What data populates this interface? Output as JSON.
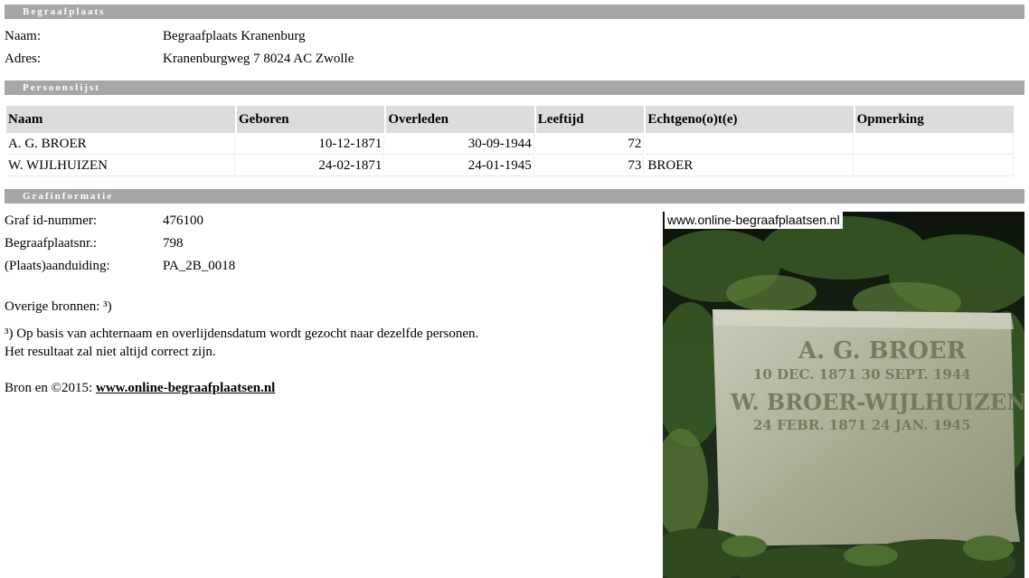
{
  "cemetery_section": {
    "title": "Begraafplaats",
    "name_label": "Naam:",
    "name_value": "Begraafplaats Kranenburg",
    "address_label": "Adres:",
    "address_value": "Kranenburgweg 7 8024 AC Zwolle"
  },
  "persons_section": {
    "title": "Persoonslijst",
    "columns": [
      "Naam",
      "Geboren",
      "Overleden",
      "Leeftijd",
      "Echtgeno(o)t(e)",
      "Opmerking"
    ],
    "rows": [
      [
        "A. G. BROER",
        "10-12-1871",
        "30-09-1944",
        "72",
        "",
        ""
      ],
      [
        "W. WIJLHUIZEN",
        "24-02-1871",
        "24-01-1945",
        "73",
        "BROER",
        ""
      ]
    ]
  },
  "grave_section": {
    "title": "Grafinformatie",
    "grave_id_label": "Graf id-nummer:",
    "grave_id_value": "476100",
    "cemetery_nr_label": "Begraafplaatsnr.:",
    "cemetery_nr_value": "798",
    "location_label": "(Plaats)aanduiding:",
    "location_value": "PA_2B_0018",
    "other_sources": "Overige bronnen: ³)",
    "footnote_line1": "³) Op basis van achternaam en overlijdensdatum wordt gezocht naar dezelfde personen.",
    "footnote_line2": "Het resultaat zal niet altijd correct zijn.",
    "source_prefix": "Bron en ©2015: ",
    "source_link": "www.online-begraafplaatsen.nl"
  },
  "photo": {
    "watermark": "www.online-begraafplaatsen.nl",
    "inscription": {
      "line1": "A. G. BROER",
      "line2": "10 DEC. 1871   30 SEPT. 1944",
      "line3": "W. BROER-WIJLHUIZEN",
      "line4": "24 FEBR. 1871   24 JAN. 1945"
    }
  }
}
